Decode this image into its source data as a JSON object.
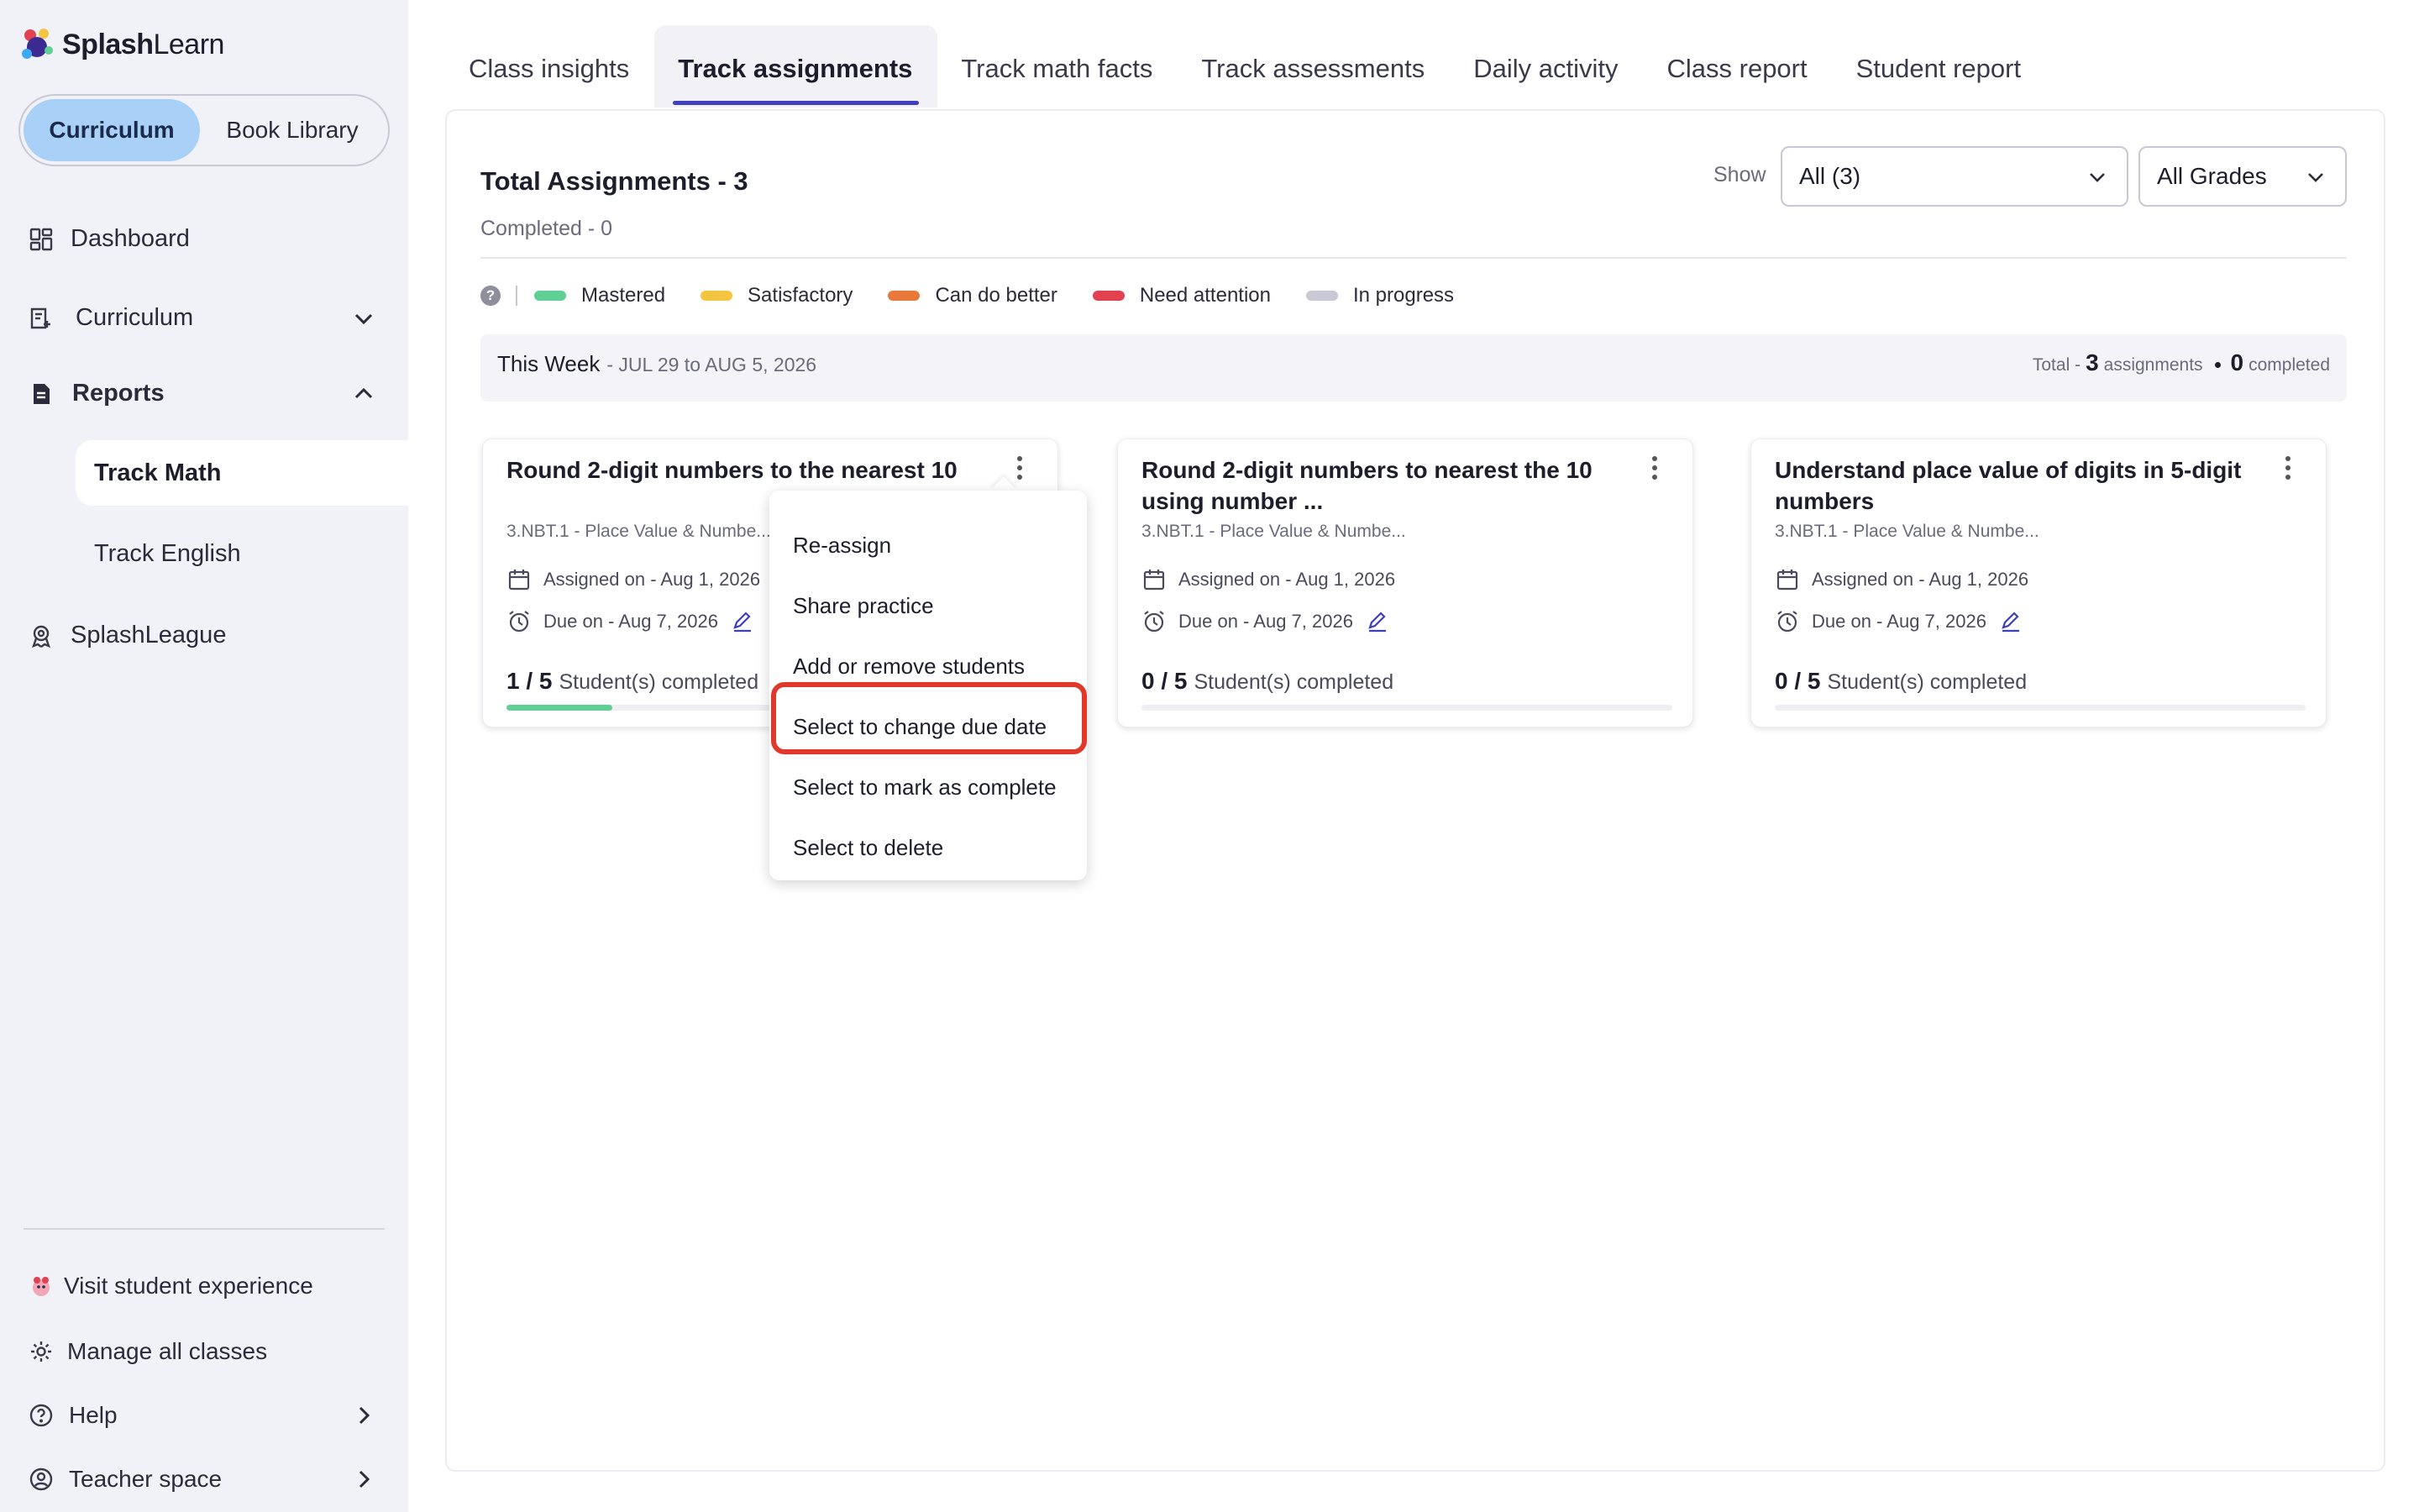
{
  "app": {
    "logo_brand": "Splash",
    "logo_brand_light": "Learn"
  },
  "sidebar": {
    "toggle": [
      "Curriculum",
      "Book Library"
    ],
    "nav": [
      {
        "label": "Dashboard",
        "icon": "dashboard-icon"
      },
      {
        "label": "Curriculum",
        "icon": "curriculum-icon"
      },
      {
        "label": "Reports",
        "icon": "reports-icon"
      }
    ],
    "reports_sub": [
      "Track Math",
      "Track English"
    ],
    "splashleague": "SplashLeague",
    "footer": [
      {
        "label": "Visit student experience",
        "icon": "student-experience-icon"
      },
      {
        "label": "Manage all classes",
        "icon": "gear-icon"
      },
      {
        "label": "Help",
        "icon": "help-icon"
      },
      {
        "label": "Teacher space",
        "icon": "teacher-icon"
      }
    ]
  },
  "tabs": [
    "Class insights",
    "Track assignments",
    "Track math facts",
    "Track assessments",
    "Daily activity",
    "Class report",
    "Student report"
  ],
  "active_tab": "Track assignments",
  "header": {
    "title": "Total Assignments - 3",
    "completed": "Completed - 0",
    "show_label": "Show",
    "filter_all": "All (3)",
    "filter_grades": "All Grades"
  },
  "legend": [
    {
      "label": "Mastered",
      "color": "#5fcf93"
    },
    {
      "label": "Satisfactory",
      "color": "#f5c542"
    },
    {
      "label": "Can do better",
      "color": "#e8793a"
    },
    {
      "label": "Need attention",
      "color": "#e2424f"
    },
    {
      "label": "In progress",
      "color": "#c9c9d6"
    }
  ],
  "week": {
    "title": "This Week",
    "range": "- JUL 29 to AUG 5, 2026",
    "total_prefix": "Total -",
    "total_count": "3",
    "total_suffix": "assignments",
    "completed_count": "0",
    "completed_suffix": "completed"
  },
  "cards": [
    {
      "title": "Round 2-digit numbers to the nearest 10",
      "standard": "3.NBT.1 - Place Value & Numbe...",
      "assigned": "Assigned on - Aug 1, 2026",
      "due": "Due on - Aug 7, 2026",
      "progress": "1 / 5",
      "progress_label": "Student(s) completed",
      "progress_fraction": 0.2
    },
    {
      "title": "Round 2-digit numbers to nearest the 10 using number ...",
      "standard": "3.NBT.1 - Place Value & Numbe...",
      "assigned": "Assigned on - Aug 1, 2026",
      "due": "Due on - Aug 7, 2026",
      "progress": "0 / 5",
      "progress_label": "Student(s) completed",
      "progress_fraction": 0
    },
    {
      "title": "Understand place value of digits in 5-digit numbers",
      "standard": "3.NBT.1 - Place Value & Numbe...",
      "assigned": "Assigned on - Aug 1, 2026",
      "due": "Due on - Aug 7, 2026",
      "progress": "0 / 5",
      "progress_label": "Student(s) completed",
      "progress_fraction": 0
    }
  ],
  "menu": {
    "items": [
      "Re-assign",
      "Share practice",
      "Add or remove students",
      "Select to change due date",
      "Select to mark as complete",
      "Select to delete"
    ],
    "highlighted": "Select to change due date",
    "highlight_color": "#e0392b"
  }
}
